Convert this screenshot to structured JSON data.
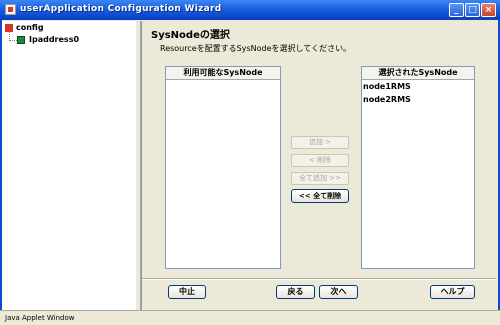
{
  "window": {
    "title": "userApplication Configuration Wizard",
    "minimize_glyph": "_",
    "maximize_glyph": "□",
    "close_glyph": "×"
  },
  "tree": {
    "root_label": "config",
    "root_icon": "config-icon",
    "child_label": "Ipaddress0",
    "child_icon": "resource-icon"
  },
  "page": {
    "title": "SysNodeの選択",
    "instruction": "Resourceを配置するSysNodeを選択してください。"
  },
  "available_list": {
    "header": "利用可能なSysNode",
    "items": []
  },
  "selected_list": {
    "header": "選択されたSysNode",
    "items": [
      "node1RMS",
      "node2RMS"
    ]
  },
  "transfer_buttons": {
    "add": "追加 >",
    "remove": "< 削除",
    "add_all": "全て追加 >>",
    "remove_all": "<< 全て削除"
  },
  "footer_buttons": {
    "cancel": "中止",
    "back": "戻る",
    "next": "次へ",
    "help": "ヘルプ"
  },
  "status": {
    "text": "Java Applet Window"
  },
  "colors": {
    "titlebar": "#0a4ad0",
    "background": "#ece9d8",
    "border": "#7f9db9"
  }
}
